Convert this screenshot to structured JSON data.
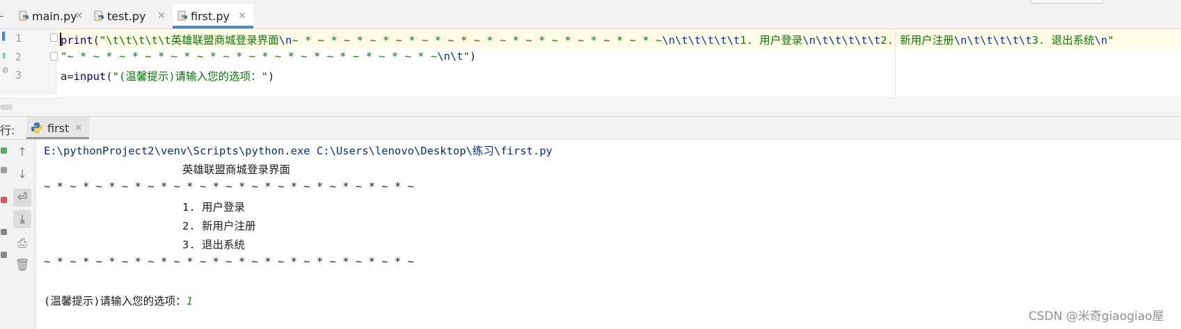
{
  "tabs": [
    {
      "label": "main.py",
      "active": false
    },
    {
      "label": "test.py",
      "active": false
    },
    {
      "label": "first.py",
      "active": true
    }
  ],
  "editor": {
    "line_numbers": [
      "1",
      "2",
      "3"
    ],
    "line1": {
      "func": "print",
      "open": "(",
      "str_a": "\"\\t\\t\\t\\t\\t英雄联盟商城登录界面",
      "esc_a": "\\n",
      "str_b": "~ * ~ * ~ * ~ * ~ * ~ * ~ * ~ * ~ * ~ * ~ * ~ * ~ * ~ * ~",
      "esc_b": "\\n\\t\\t\\t\\t\\t",
      "str_c": "1. 用户登录",
      "esc_c": "\\n\\t\\t\\t\\t\\t",
      "str_d": "2. 新用户注册",
      "esc_d": "\\n\\t\\t\\t\\t\\t",
      "str_e": "3. 退出系统",
      "esc_e": "\\n",
      "str_f": "\""
    },
    "line2": {
      "str_a": "\"~ * ~ * ~ * ~ * ~ * ~ * ~ * ~ * ~ * ~ * ~ * ~ * ~ * ~ * ~",
      "esc_a": "\\n\\t",
      "str_b": "\"",
      "close": ")"
    },
    "line3": {
      "var": "a=",
      "func": "input",
      "open": "(",
      "str": "\"(温馨提示)请输入您的选项：\"",
      "close": ")"
    }
  },
  "run": {
    "label": "行:",
    "tab_label": "first",
    "output": {
      "cmd": "E:\\pythonProject2\\venv\\Scripts\\python.exe C:\\Users\\lenovo\\Desktop\\练习\\first.py",
      "title": "英雄联盟商城登录界面",
      "divider": "~ * ~ * ~ * ~ * ~ * ~ * ~ * ~ * ~ * ~ * ~ * ~ * ~ * ~ * ~",
      "opt1": "1. 用户登录",
      "opt2": "2. 新用户注册",
      "opt3": "3. 退出系统",
      "prompt": "(温馨提示)请输入您的选项：",
      "user_input": "1"
    }
  },
  "watermark": "CSDN @米奇giaogiao屋",
  "colors": {
    "accent": "#4a88c7",
    "keyword": "#00008b",
    "string": "#077a07",
    "escape": "#0037a6",
    "user_input": "#1f8b1f"
  }
}
